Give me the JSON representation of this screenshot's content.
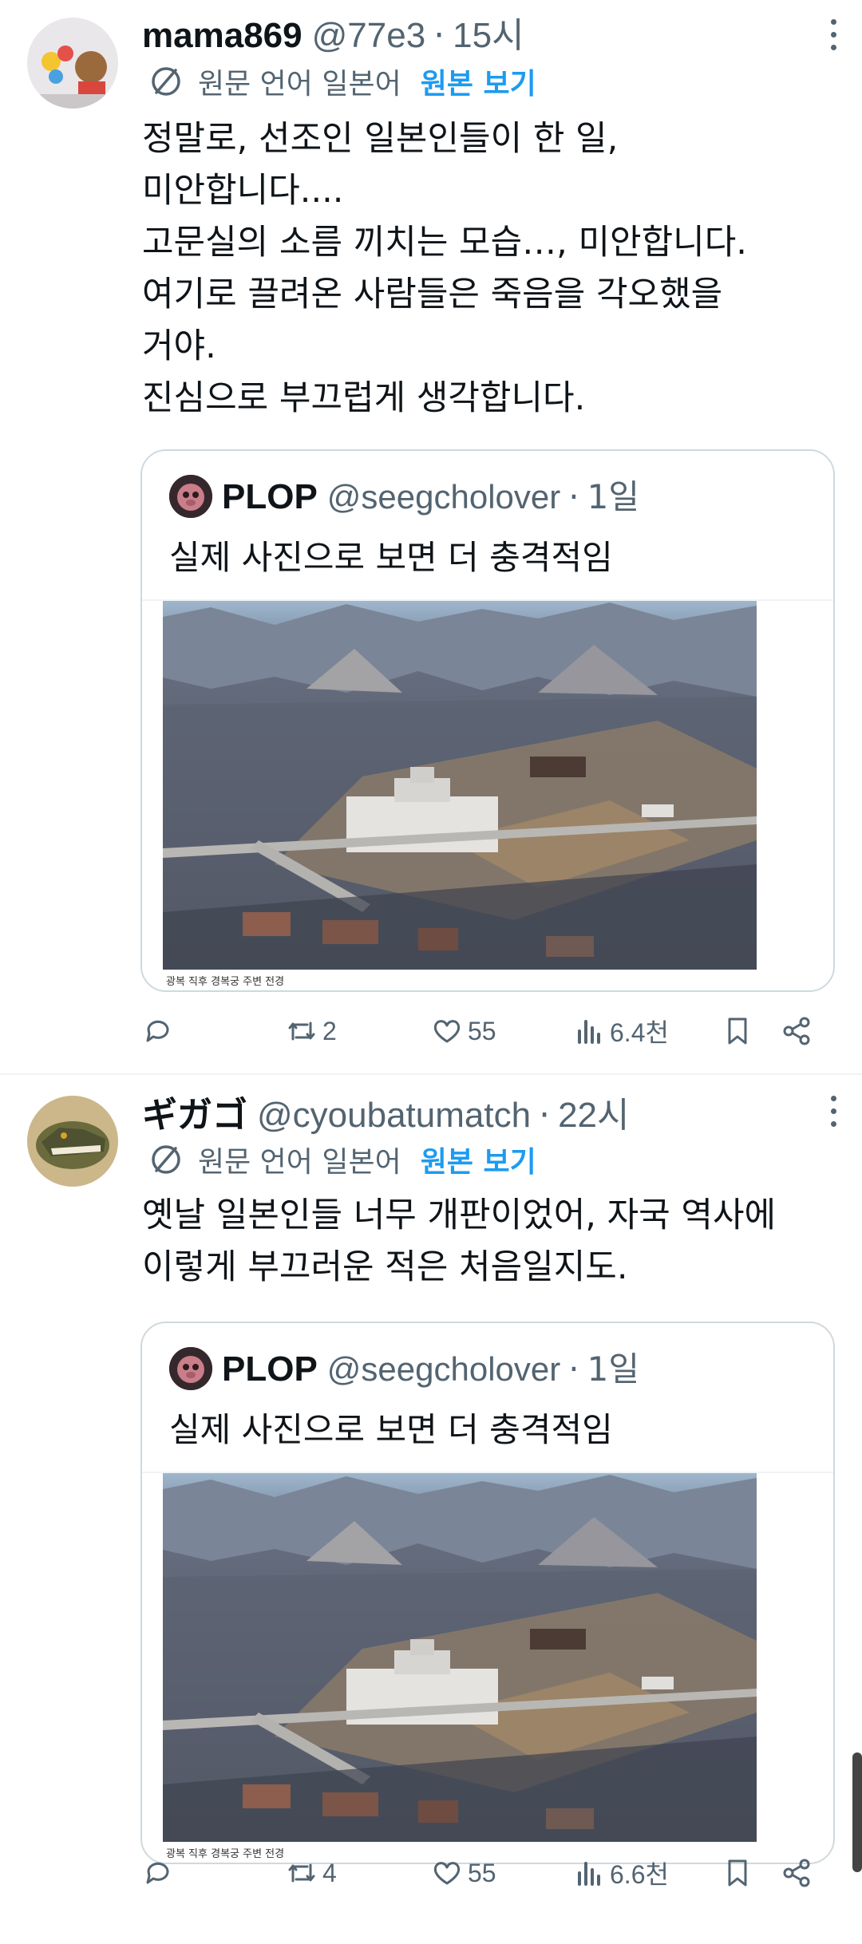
{
  "tweets": [
    {
      "author_name": "mama869",
      "handle": "@77e3",
      "dot": "·",
      "time": "15시",
      "translation": {
        "original_language": "원문 언어 일본어",
        "show_original": "원본 보기"
      },
      "body_lines": [
        "정말로, 선조인 일본인들이 한 일,",
        "미안합니다....",
        "고문실의 소름 끼치는 모습…, 미안합니다.",
        "여기로 끌려온 사람들은 죽음을 각오했을",
        "거야.",
        "진심으로 부끄럽게 생각합니다."
      ],
      "quote": {
        "author_name": "PLOP",
        "handle": "@seegcholover",
        "dot": "·",
        "time": "1일",
        "text": "실제 사진으로 보면 더 충격적임",
        "photo_caption": "광복 직후 경복궁 주변 전경"
      },
      "stats": {
        "replies": "",
        "retweets": "2",
        "likes": "55",
        "views": "6.4천"
      }
    },
    {
      "author_name": "ギガゴ",
      "handle": "@cyoubatumatch",
      "dot": "·",
      "time": "22시",
      "translation": {
        "original_language": "원문 언어 일본어",
        "show_original": "원본 보기"
      },
      "body_lines": [
        "옛날 일본인들 너무 개판이었어, 자국 역사에",
        "이렇게 부끄러운 적은 처음일지도."
      ],
      "quote": {
        "author_name": "PLOP",
        "handle": "@seegcholover",
        "dot": "·",
        "time": "1일",
        "text": "실제 사진으로 보면 더 충격적임",
        "photo_caption": "광복 직후 경복궁 주변 전경"
      },
      "stats": {
        "replies": "",
        "retweets": "4",
        "likes": "55",
        "views": "6.6천"
      }
    }
  ],
  "colors": {
    "text": "#0f1419",
    "secondary": "#536471",
    "link": "#1d9bf0",
    "border": "#cfd9de"
  },
  "icons": [
    "reply-icon",
    "retweet-icon",
    "like-icon",
    "views-icon",
    "bookmark-icon",
    "share-icon",
    "more-icon",
    "translate-icon"
  ]
}
